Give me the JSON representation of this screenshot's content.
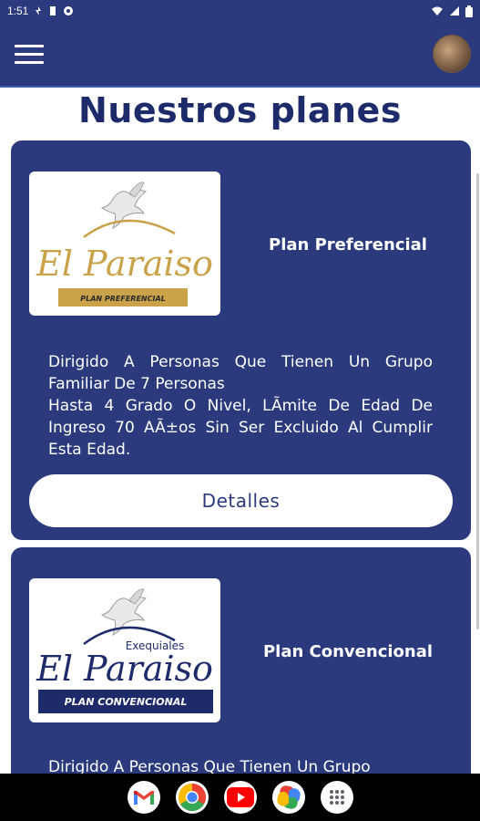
{
  "status_bar": {
    "time": "1:51"
  },
  "app_bar": {
    "menu_icon": "hamburger-menu-icon",
    "avatar_icon": "user-avatar"
  },
  "page": {
    "title": "Nuestros planes"
  },
  "plans": [
    {
      "logo_brand": "El Paraiso",
      "logo_subtitle": "PLAN PREFERENCIAL",
      "name": "Plan Preferencial",
      "description": "Dirigido A Personas Que Tienen Un Grupo Familiar De 7 Personas\nHasta 4 Grado O Nivel, LÃmite De Edad De Ingreso 70 AÃ±os Sin Ser Excluido Al Cumplir Esta Edad.",
      "details_label": "Detalles",
      "brand_color": "#c9a24a"
    },
    {
      "logo_brand": "El Paraiso",
      "logo_top": "Exequiales",
      "logo_subtitle": "PLAN CONVENCIONAL",
      "name": "Plan Convencional",
      "description": "Dirigido A Personas Que Tienen Un Grupo",
      "brand_color": "#1e2b6b"
    }
  ],
  "nav_apps": [
    {
      "name": "gmail-icon"
    },
    {
      "name": "chrome-icon"
    },
    {
      "name": "youtube-icon"
    },
    {
      "name": "photos-icon"
    },
    {
      "name": "app-drawer-icon"
    }
  ],
  "colors": {
    "primary": "#2b3a7c",
    "title": "#1e2b6b",
    "gold": "#c9a24a"
  }
}
